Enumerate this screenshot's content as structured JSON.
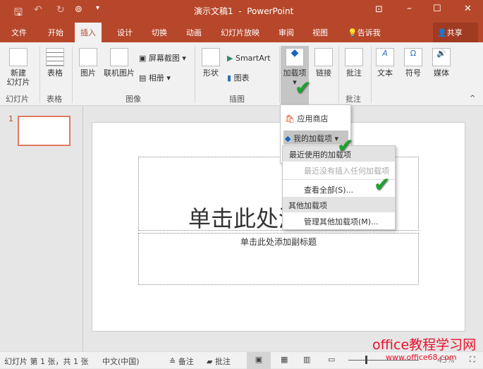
{
  "titlebar": {
    "title": "演示文稿1  -  PowerPoint"
  },
  "tabs": [
    "文件",
    "开始",
    "插入",
    "设计",
    "切换",
    "动画",
    "幻灯片放映",
    "审阅",
    "视图"
  ],
  "tell_me": "告诉我",
  "share": "共享",
  "ribbon": {
    "new_slide": "新建\n幻灯片",
    "table": "表格",
    "picture": "图片",
    "online_picture": "联机图片",
    "screenshot": "屏幕截图",
    "album": "相册",
    "shapes": "形状",
    "smartart": "SmartArt",
    "chart": "图表",
    "addins": "加载项",
    "links": "链接",
    "comment": "批注",
    "text": "文本",
    "symbols": "符号",
    "media": "媒体",
    "groups": {
      "slides": "幻灯片",
      "tables": "表格",
      "images": "图像",
      "illustrations": "插图",
      "comments": "批注"
    }
  },
  "addins_menu": {
    "store": "应用商店",
    "my_addins": "我的加载项"
  },
  "submenu": {
    "recent_header": "最近使用的加载项",
    "recent_empty": "最近没有插入任何加载项",
    "see_all": "查看全部(S)...",
    "other_header": "其他加载项",
    "manage": "管理其他加载项(M)..."
  },
  "slide_panel": {
    "number": "1"
  },
  "slide": {
    "title_placeholder": "单击此处添加标题",
    "subtitle_placeholder": "单击此处添加副标题"
  },
  "status": {
    "slide_info": "幻灯片 第 1 张，共 1 张",
    "language": "中文(中国)",
    "notes": "备注",
    "comments": "批注",
    "zoom": "43%"
  },
  "watermark": {
    "name": "office教程学习网",
    "url": "www.office68.com"
  },
  "colors": {
    "accent": "#b7472a",
    "check": "#1aa52c"
  }
}
